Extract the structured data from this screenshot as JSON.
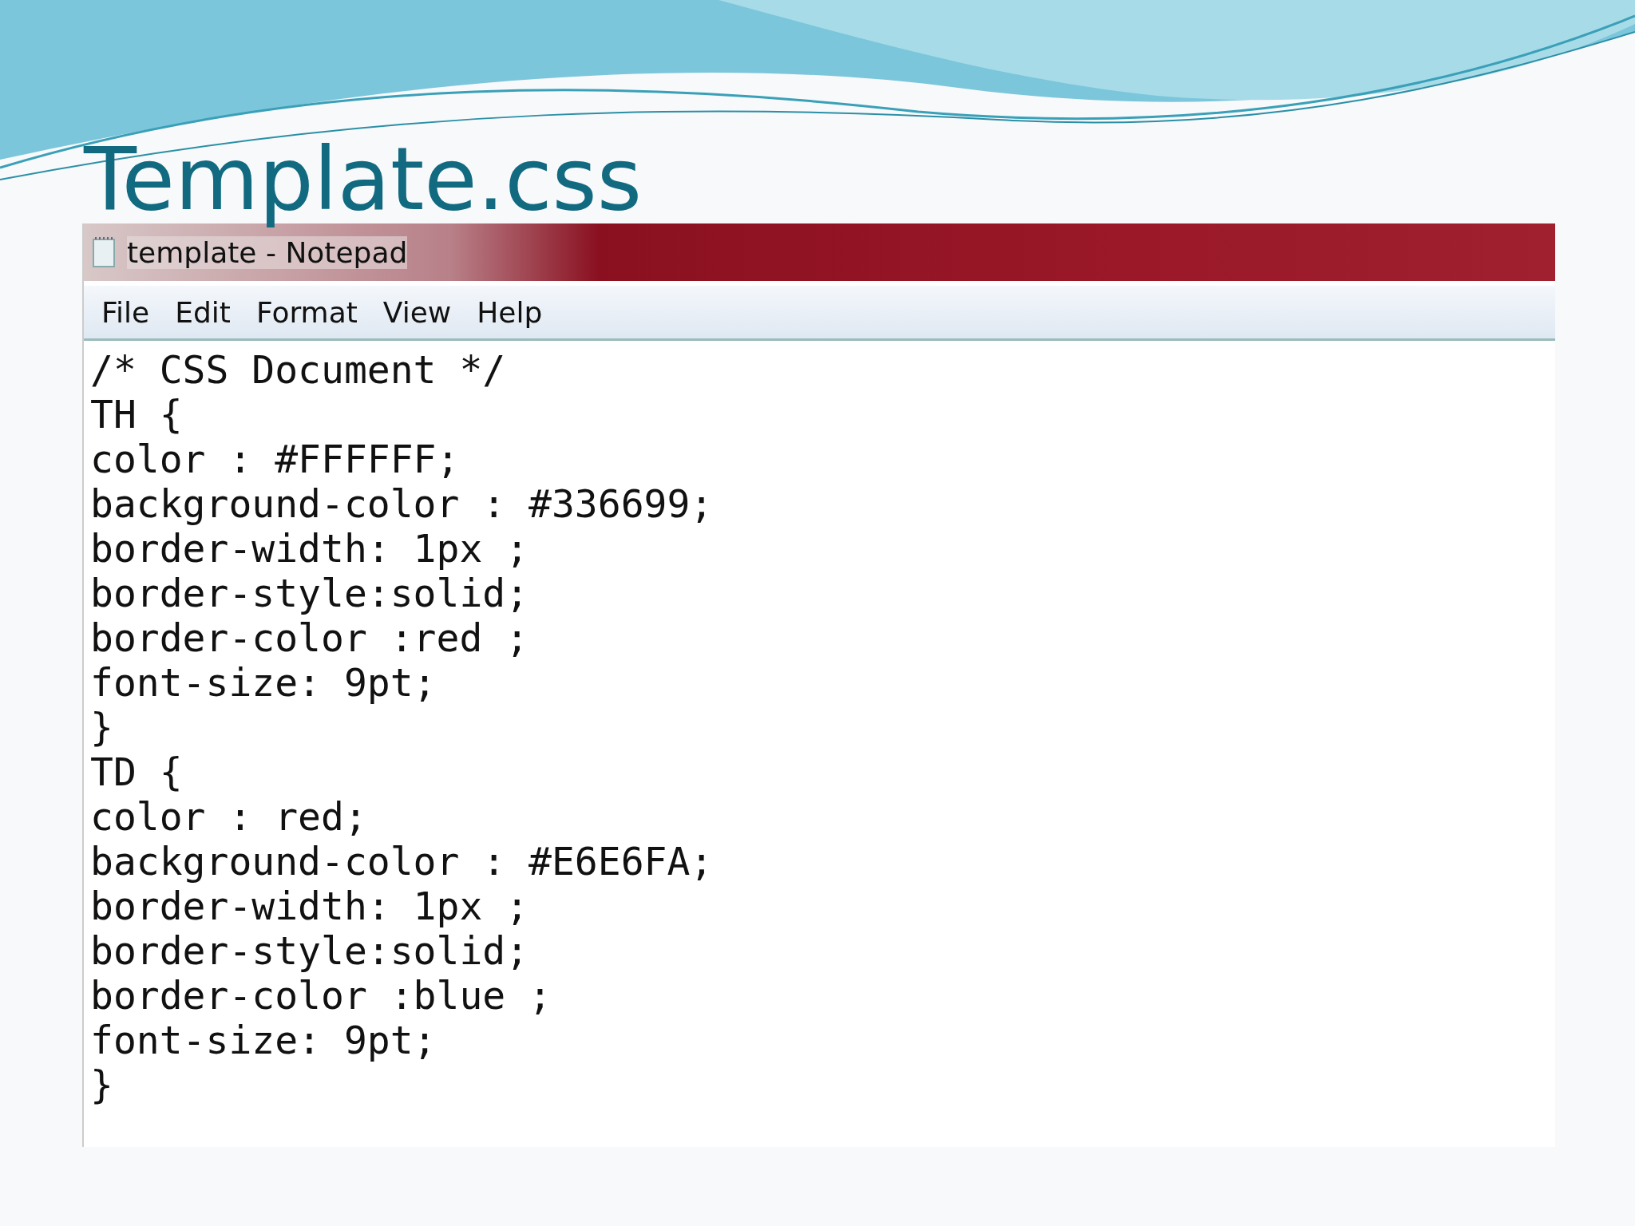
{
  "slide_title": "Template.css",
  "window": {
    "title": "template - Notepad"
  },
  "menu": [
    "File",
    "Edit",
    "Format",
    "View",
    "Help"
  ],
  "lines": [
    "/* CSS Document */",
    "TH {",
    "color : #FFFFFF;",
    "background-color : #336699;",
    "border-width: 1px ;",
    "border-style:solid;",
    "border-color :red ;",
    "font-size: 9pt;",
    "}",
    "TD {",
    "color : red;",
    "background-color : #E6E6FA;",
    "border-width: 1px ;",
    "border-style:solid;",
    "border-color :blue ;",
    "font-size: 9pt;",
    "}"
  ]
}
